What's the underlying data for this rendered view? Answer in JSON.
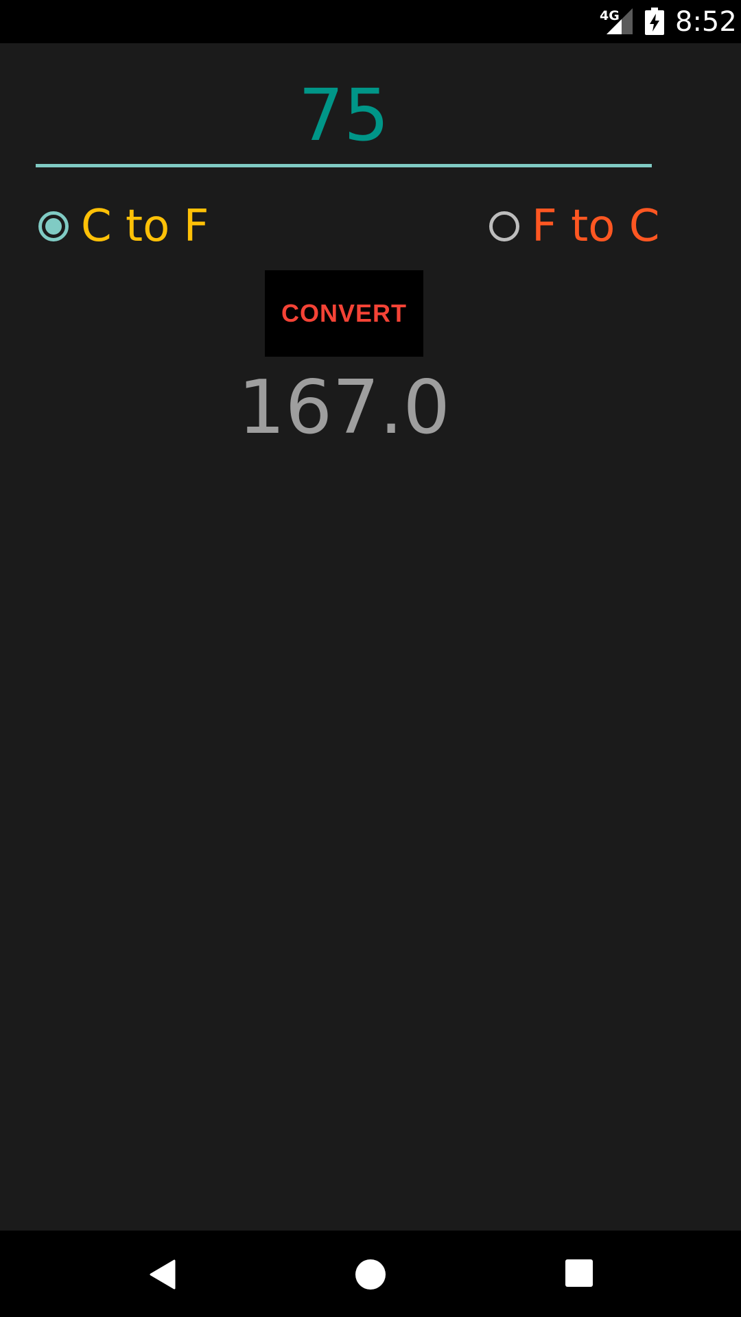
{
  "status_bar": {
    "network_type": "4G",
    "time": "8:52",
    "icons": [
      "signal-icon",
      "battery-charging-icon"
    ]
  },
  "converter": {
    "input_value": "75",
    "options": [
      {
        "label": "C to F",
        "selected": true
      },
      {
        "label": "F to C",
        "selected": false
      }
    ],
    "convert_label": "CONVERT",
    "result": "167.0"
  },
  "nav_bar": {
    "icons": [
      "back-icon",
      "home-icon",
      "recents-icon"
    ]
  },
  "colors": {
    "background": "#1b1b1b",
    "input_text": "#009688",
    "accent": "#80cbc4",
    "option_ctof": "#ffc107",
    "option_ftoc": "#ff5722",
    "button_text": "#f44336",
    "result_text": "#9e9e9e"
  }
}
